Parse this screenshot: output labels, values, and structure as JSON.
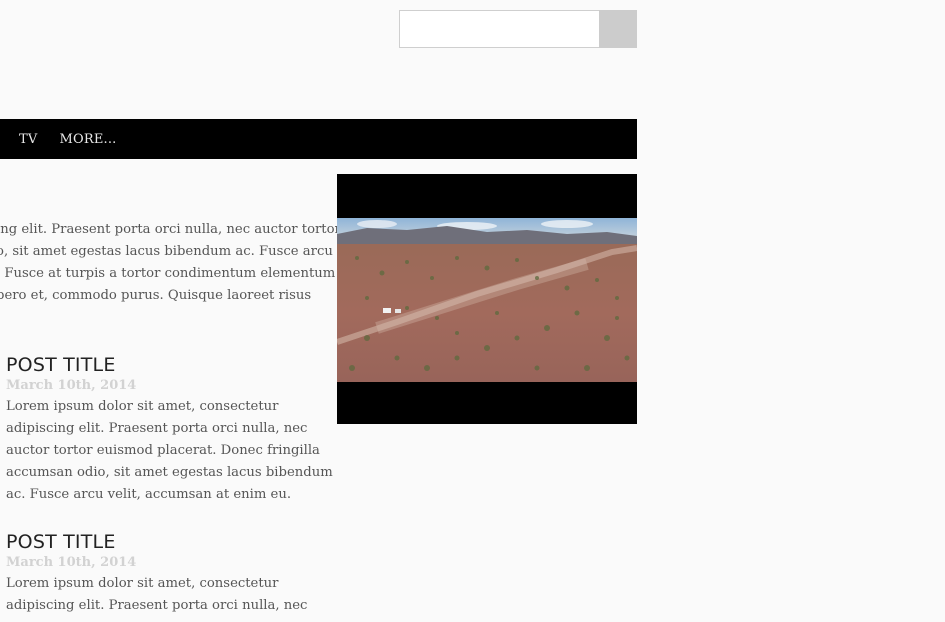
{
  "search": {
    "value": "",
    "placeholder": ""
  },
  "nav": {
    "items": [
      "TV",
      "MORE..."
    ]
  },
  "intro": {
    "lines": [
      "ing elit. Praesent porta orci nulla, nec auctor tortor",
      "o, sit amet egestas lacus bibendum ac. Fusce arcu",
      ". Fusce at turpis a tortor condimentum elementum",
      "bero et, commodo purus. Quisque laoreet risus"
    ]
  },
  "posts": [
    {
      "title": "POST TITLE",
      "date": "March 10th, 2014",
      "lines": [
        "Lorem ipsum dolor sit amet, consectetur",
        "adipiscing elit. Praesent porta orci nulla, nec",
        "auctor tortor euismod placerat. Donec fringilla",
        "accumsan odio, sit amet egestas lacus bibendum",
        "ac. Fusce arcu velit, accumsan at enim eu."
      ]
    },
    {
      "title": "POST TITLE",
      "date": "March 10th, 2014",
      "lines": [
        "Lorem ipsum dolor sit amet, consectetur",
        "adipiscing elit. Praesent porta orci nulla, nec"
      ]
    }
  ],
  "video": {
    "scene": "desert-road-with-vehicle"
  },
  "colors": {
    "background": "#fafafa",
    "nav_bg": "#000000",
    "nav_text": "#e8e8e8",
    "search_button": "#cccccc",
    "date_text": "#d2d2d2",
    "title_text": "#222222",
    "body_text": "#555555"
  }
}
